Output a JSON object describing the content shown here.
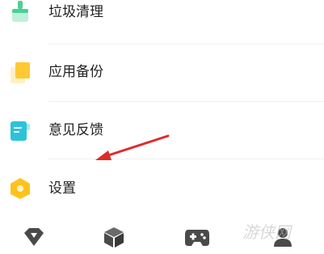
{
  "menu": {
    "items": [
      {
        "label": "垃圾清理",
        "icon": "broom-icon",
        "color": "#4ccf94"
      },
      {
        "label": "应用备份",
        "icon": "backup-icon",
        "color": "#ffc933"
      },
      {
        "label": "意见反馈",
        "icon": "feedback-icon",
        "color": "#2cc3d9"
      },
      {
        "label": "设置",
        "icon": "settings-icon",
        "color": "#ffc21c"
      }
    ]
  },
  "tabbar": {
    "tabs": [
      {
        "icon": "diamond-icon"
      },
      {
        "icon": "box-icon"
      },
      {
        "icon": "gamepad-icon"
      },
      {
        "icon": "person-icon"
      }
    ],
    "icon_color": "#4a4a4a"
  },
  "annotation": {
    "arrow_color": "#e02a2a"
  },
  "watermark": {
    "text": "游侠网"
  }
}
